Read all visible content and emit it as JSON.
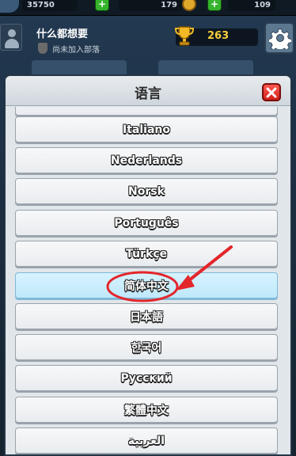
{
  "background": {
    "resources": {
      "elixir": "35750",
      "gold": "179",
      "gems": "109"
    },
    "player": {
      "name": "什么都想要",
      "clan_status": "尚未加入部落",
      "trophies": "263"
    }
  },
  "modal": {
    "title": "语言",
    "languages": [
      {
        "label": "Italiano"
      },
      {
        "label": "Nederlands"
      },
      {
        "label": "Norsk"
      },
      {
        "label": "Português"
      },
      {
        "label": "Türkçe"
      },
      {
        "label": "简体中文",
        "selected": true
      },
      {
        "label": "日本語"
      },
      {
        "label": "한국어"
      },
      {
        "label": "Русский"
      },
      {
        "label": "繁體中文"
      },
      {
        "label": "العربية"
      }
    ]
  },
  "colors": {
    "selected": "#bfe8fb",
    "annotation": "#e3262b",
    "close": "#d11f1a"
  }
}
